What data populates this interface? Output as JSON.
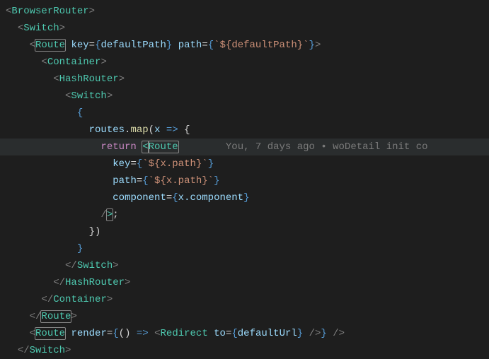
{
  "code": {
    "tags": {
      "browserRouter": "BrowserRouter",
      "switch": "Switch",
      "route": "Route",
      "container": "Container",
      "hashRouter": "HashRouter",
      "redirect": "Redirect"
    },
    "attrs": {
      "key": "key",
      "path": "path",
      "component": "component",
      "render": "render",
      "to": "to"
    },
    "vars": {
      "defaultPath": "defaultPath",
      "defaultUrl": "defaultUrl",
      "routes": "routes",
      "x": "x",
      "xPath": "x.path",
      "xComponent": "x.component"
    },
    "fns": {
      "map": "map"
    },
    "kws": {
      "return": "return"
    },
    "tpl": {
      "defaultPathExpr": "`${defaultPath}`",
      "xPathExpr": "`${x.path}`"
    }
  },
  "codelens": {
    "text": "You, 7 days ago • woDetail init co"
  }
}
